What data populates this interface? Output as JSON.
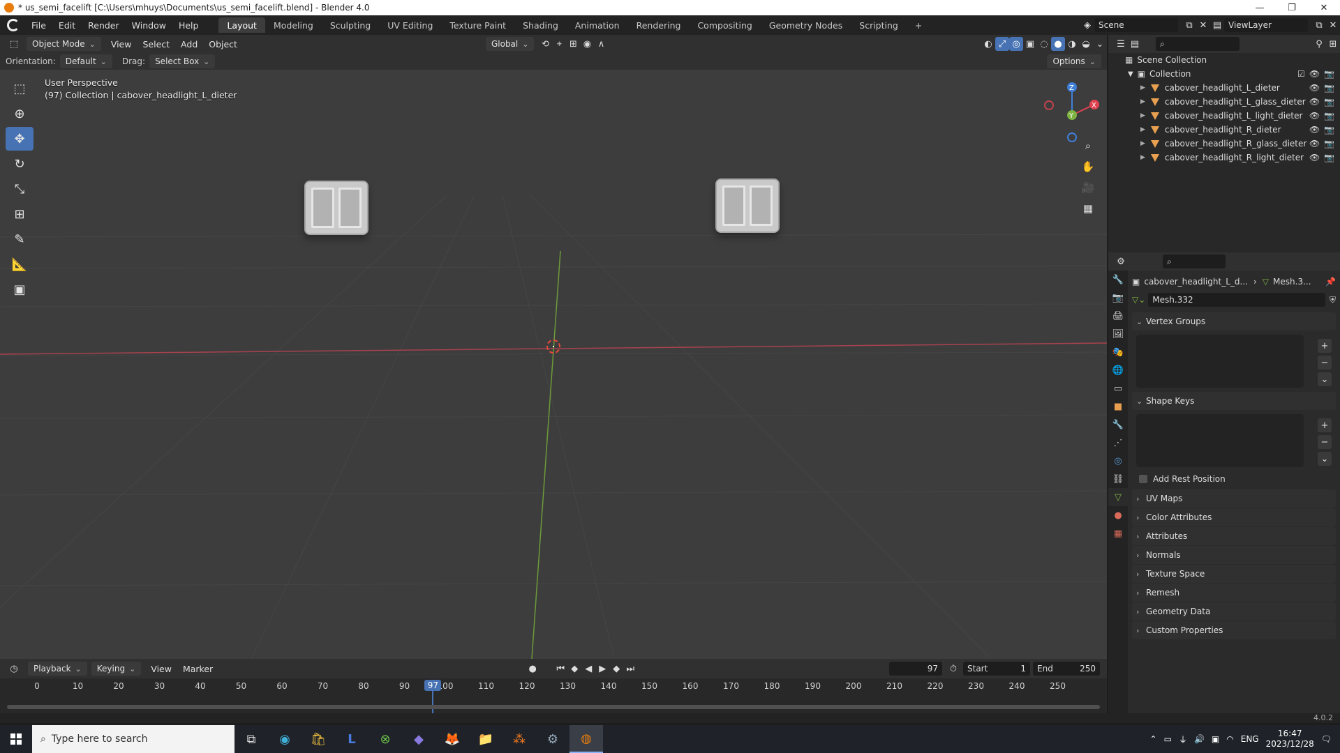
{
  "window": {
    "title": "* us_semi_facelift [C:\\Users\\mhuys\\Documents\\us_semi_facelift.blend] - Blender 4.0",
    "minimize": "—",
    "maximize": "❐",
    "close": "✕"
  },
  "menu": [
    "File",
    "Edit",
    "Render",
    "Window",
    "Help"
  ],
  "workspaces": [
    "Layout",
    "Modeling",
    "Sculpting",
    "UV Editing",
    "Texture Paint",
    "Shading",
    "Animation",
    "Rendering",
    "Compositing",
    "Geometry Nodes",
    "Scripting"
  ],
  "active_workspace": "Layout",
  "add_workspace": "+",
  "scene": {
    "label": "Scene",
    "view_layer": "ViewLayer"
  },
  "viewport_header": {
    "mode": "Object Mode",
    "menus": [
      "View",
      "Select",
      "Add",
      "Object"
    ],
    "transform_orientation": "Global",
    "options": "Options"
  },
  "tool_header": {
    "orientation_label": "Orientation:",
    "orientation_value": "Default",
    "drag_label": "Drag:",
    "drag_value": "Select Box"
  },
  "viewport": {
    "perspective": "User Perspective",
    "collection_info": "(97) Collection | cabover_headlight_L_dieter",
    "gizmo": {
      "z": "Z",
      "y": "Y",
      "x": "X"
    }
  },
  "timeline": {
    "menus": [
      "Playback",
      "Keying",
      "View",
      "Marker"
    ],
    "current_frame": "97",
    "start_label": "Start",
    "start": "1",
    "end_label": "End",
    "end": "250",
    "ticks": [
      "0",
      "10",
      "20",
      "30",
      "40",
      "50",
      "60",
      "70",
      "80",
      "90",
      "100",
      "110",
      "120",
      "130",
      "140",
      "150",
      "160",
      "170",
      "180",
      "190",
      "200",
      "210",
      "220",
      "230",
      "240",
      "250"
    ],
    "playhead_label": "97"
  },
  "outliner": {
    "root": "Scene Collection",
    "collection": "Collection",
    "objects": [
      "cabover_headlight_L_dieter",
      "cabover_headlight_L_glass_dieter",
      "cabover_headlight_L_light_dieter",
      "cabover_headlight_R_dieter",
      "cabover_headlight_R_glass_dieter",
      "cabover_headlight_R_light_dieter"
    ]
  },
  "properties": {
    "breadcrumb_object": "cabover_headlight_L_d...",
    "breadcrumb_mesh": "Mesh.3...",
    "mesh_name": "Mesh.332",
    "panels_open": [
      "Vertex Groups",
      "Shape Keys"
    ],
    "add_rest_position": "Add Rest Position",
    "panels_closed": [
      "UV Maps",
      "Color Attributes",
      "Attributes",
      "Normals",
      "Texture Space",
      "Remesh",
      "Geometry Data",
      "Custom Properties"
    ]
  },
  "version": "4.0.2",
  "taskbar": {
    "search_placeholder": "Type here to search",
    "language": "ENG",
    "time": "16:47",
    "date": "2023/12/28"
  },
  "colors": {
    "accent": "#4772b3",
    "x_axis": "#e0424f",
    "y_axis": "#7fb342",
    "z_axis": "#3f7fd8",
    "object_orange": "#e8a050"
  }
}
